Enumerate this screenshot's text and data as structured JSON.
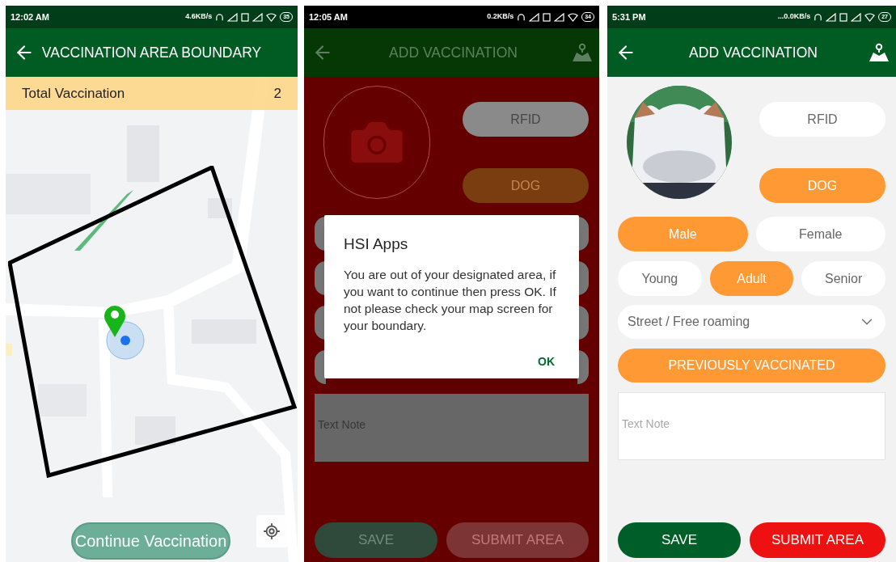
{
  "screens": [
    {
      "kind": "map",
      "status_bar": {
        "time": "12:02 AM",
        "speed": "4.6KB/s",
        "battery": "35"
      },
      "header": {
        "title": "VACCINATION AREA BOUNDARY"
      },
      "summary": {
        "label": "Total Vaccination",
        "value": "2"
      },
      "continue_button": "Continue Vaccination"
    },
    {
      "kind": "form",
      "dimmed": true,
      "status_bar": {
        "time": "12:05 AM",
        "speed": "0.2KB/s",
        "battery": "34"
      },
      "header": {
        "title": "ADD VACCINATION"
      },
      "photo": {
        "kind": "camera"
      },
      "options": [
        {
          "label": "RFID",
          "selected": false
        },
        {
          "label": "DOG",
          "selected": true
        }
      ],
      "note": {
        "placeholder": "Text Note"
      },
      "actions": [
        {
          "label": "SAVE",
          "kind": "save"
        },
        {
          "label": "SUBMIT AREA",
          "kind": "submit"
        }
      ],
      "dialog": {
        "title": "HSI Apps",
        "message": "You are out of your designated area, if you want to continue then press OK. If not please check your map screen for your boundary.",
        "button": "OK"
      }
    },
    {
      "kind": "form",
      "dimmed": false,
      "status_bar": {
        "time": "5:31 PM",
        "speed": "...0.0KB/s",
        "battery": "27"
      },
      "header": {
        "title": "ADD VACCINATION"
      },
      "photo": {
        "kind": "picture"
      },
      "options": [
        {
          "label": "RFID",
          "selected": false
        },
        {
          "label": "DOG",
          "selected": true
        }
      ],
      "gender": [
        {
          "label": "Male",
          "selected": true
        },
        {
          "label": "Female",
          "selected": false
        }
      ],
      "age": [
        {
          "label": "Young",
          "selected": false
        },
        {
          "label": "Adult",
          "selected": true
        },
        {
          "label": "Senior",
          "selected": false
        }
      ],
      "habitat": {
        "value": "Street / Free roaming"
      },
      "previously_vaccinated": {
        "label": "PREVIOUSLY VACCINATED",
        "selected": true
      },
      "note": {
        "placeholder": "Text Note"
      },
      "actions": [
        {
          "label": "SAVE",
          "kind": "save"
        },
        {
          "label": "SUBMIT AREA",
          "kind": "submit"
        }
      ]
    }
  ]
}
